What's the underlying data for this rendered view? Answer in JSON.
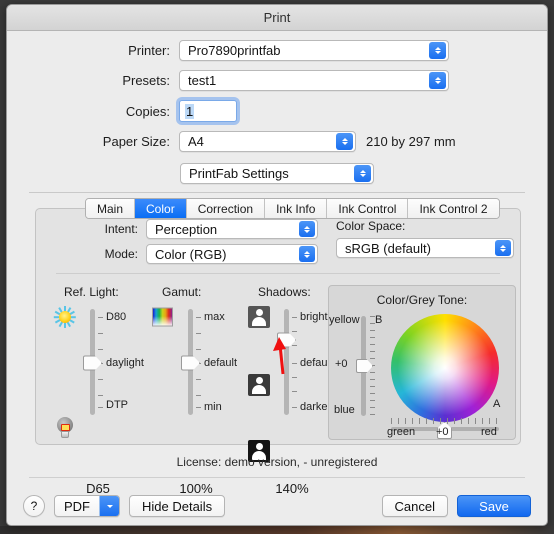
{
  "window": {
    "title": "Print"
  },
  "form": {
    "printer_label": "Printer:",
    "printer_value": "Pro7890printfab",
    "presets_label": "Presets:",
    "presets_value": "test1",
    "copies_label": "Copies:",
    "copies_value": "1",
    "paper_label": "Paper Size:",
    "paper_value": "A4",
    "paper_note": "210 by 297 mm",
    "settings_value": "PrintFab Settings"
  },
  "tabs": [
    {
      "label": "Main",
      "active": false
    },
    {
      "label": "Color",
      "active": true
    },
    {
      "label": "Correction",
      "active": false
    },
    {
      "label": "Ink Info",
      "active": false
    },
    {
      "label": "Ink Control",
      "active": false
    },
    {
      "label": "Ink Control 2",
      "active": false
    }
  ],
  "color_panel": {
    "intent_label": "Intent:",
    "intent_value": "Perception",
    "mode_label": "Mode:",
    "mode_value": "Color (RGB)",
    "colorspace_label": "Color Space:",
    "colorspace_value": "sRGB (default)"
  },
  "sliders": [
    {
      "title": "Ref. Light:",
      "top_label": "D80",
      "mid_label": "daylight",
      "bottom_label": "DTP",
      "value": "D65",
      "thumb_percent": 50,
      "top_icon": "sun-icon",
      "bottom_icon": "lamp-icon"
    },
    {
      "title": "Gamut:",
      "top_label": "max",
      "mid_label": "default",
      "bottom_label": "min",
      "value": "100%",
      "thumb_percent": 50,
      "top_icon": "gamut-gradient-icon",
      "bottom_icon": ""
    },
    {
      "title": "Shadows:",
      "top_label": "brighter",
      "mid_label": "default",
      "bottom_label": "darker",
      "value": "140%",
      "thumb_percent": 28,
      "top_icon": "person-bright-icon",
      "bottom_icon": "person-dark-icon"
    }
  ],
  "tone": {
    "title": "Color/Grey Tone:",
    "b_axis_label": "B",
    "b_top_label": "yellow",
    "b_bottom_label": "blue",
    "b_value": "+0",
    "a_axis_label": "A",
    "a_left_label": "green",
    "a_right_label": "red",
    "a_value": "+0"
  },
  "license": "License: demo version,  - unregistered",
  "footer": {
    "help_label": "?",
    "pdf_label": "PDF",
    "hide_details_label": "Hide Details",
    "cancel_label": "Cancel",
    "save_label": "Save"
  },
  "colors": {
    "accent_blue": "#1a6ff0",
    "window_bg": "#ececec",
    "panel_bg": "#e3e3e3",
    "tone_panel_bg": "#d7d7d7",
    "annotation_red": "#f01010"
  }
}
